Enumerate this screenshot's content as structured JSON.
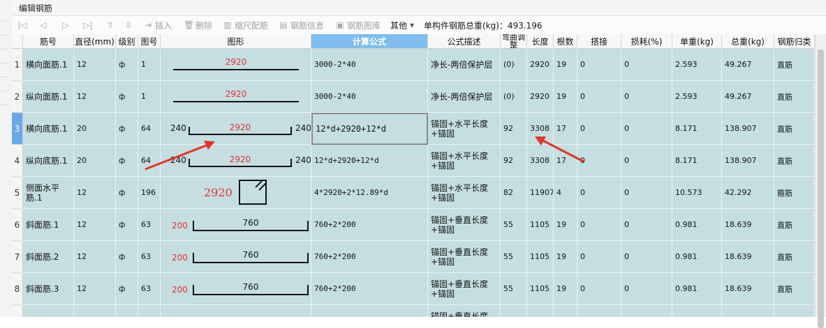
{
  "window": {
    "title": "编辑钢筋"
  },
  "toolbar": {
    "insert": "插入",
    "delete": "删除",
    "scale_rebar": "缩尺配筋",
    "rebar_info": "钢筋信息",
    "rebar_library": "钢筋图库",
    "other": "其他",
    "total_weight_label": "单构件钢筋总重(kg)：493.196"
  },
  "columns": [
    "筋号",
    "直径(mm)",
    "级别",
    "图号",
    "图形",
    "计算公式",
    "公式描述",
    "弯曲调整",
    "长度",
    "根数",
    "搭接",
    "损耗(%)",
    "单重(kg)",
    "总重(kg)",
    "钢筋归类"
  ],
  "rows": [
    {
      "num": "1",
      "name": "横向面筋.1",
      "dia": "12",
      "grade": "ф",
      "fig": "1",
      "shape": {
        "type": "straight",
        "mid": "2920"
      },
      "formula": "3000-2*40",
      "desc": "净长-两倍保护层",
      "bend": "(0)",
      "len": "2920",
      "count": "19",
      "lap": "0",
      "loss": "0",
      "unit": "2.593",
      "total": "49.267",
      "cat": "直筋"
    },
    {
      "num": "2",
      "name": "纵向面筋.1",
      "dia": "12",
      "grade": "ф",
      "fig": "1",
      "shape": {
        "type": "straight",
        "mid": "2920"
      },
      "formula": "3000-2*40",
      "desc": "净长-两倍保护层",
      "bend": "(0)",
      "len": "2920",
      "count": "19",
      "lap": "0",
      "loss": "0",
      "unit": "2.593",
      "total": "49.267",
      "cat": "直筋"
    },
    {
      "num": "3",
      "name": "横向底筋.1",
      "dia": "20",
      "grade": "ф",
      "fig": "64",
      "shape": {
        "type": "hooked",
        "left": "240",
        "mid": "2920",
        "right": "240"
      },
      "formula": "12*d+2920+12*d",
      "desc": "锚固+水平长度+锚固",
      "bend": "92",
      "len": "3308",
      "count": "17",
      "lap": "0",
      "loss": "0",
      "unit": "8.171",
      "total": "138.907",
      "cat": "直筋"
    },
    {
      "num": "4",
      "name": "纵向底筋.1",
      "dia": "20",
      "grade": "ф",
      "fig": "64",
      "shape": {
        "type": "hooked",
        "left": "240",
        "mid": "2920",
        "right": "240"
      },
      "formula": "12*d+2920+12*d",
      "desc": "锚固+水平长度+锚固",
      "bend": "92",
      "len": "3308",
      "count": "17",
      "lap": "0",
      "loss": "0",
      "unit": "8.171",
      "total": "138.907",
      "cat": "直筋"
    },
    {
      "num": "5",
      "name": "侧面水平筋.1",
      "dia": "12",
      "grade": "ф",
      "fig": "196",
      "shape": {
        "type": "stirrup",
        "mid": "2920"
      },
      "formula": "4*2920+2*12.89*d",
      "desc": "锚固+水平长度+锚固",
      "bend": "82",
      "len": "11907",
      "count": "4",
      "lap": "0",
      "loss": "0",
      "unit": "10.573",
      "total": "42.292",
      "cat": "箍筋"
    },
    {
      "num": "6",
      "name": "斜面筋.1",
      "dia": "12",
      "grade": "ф",
      "fig": "63",
      "shape": {
        "type": "uplegs",
        "left": "200",
        "mid": "760"
      },
      "formula": "760+2*200",
      "desc": "锚固+垂直长度+锚固",
      "bend": "55",
      "len": "1105",
      "count": "19",
      "lap": "0",
      "loss": "0",
      "unit": "0.981",
      "total": "18.639",
      "cat": "直筋"
    },
    {
      "num": "7",
      "name": "斜面筋.2",
      "dia": "12",
      "grade": "ф",
      "fig": "63",
      "shape": {
        "type": "uplegs",
        "left": "200",
        "mid": "760"
      },
      "formula": "760+2*200",
      "desc": "锚固+垂直长度+锚固",
      "bend": "55",
      "len": "1105",
      "count": "19",
      "lap": "0",
      "loss": "0",
      "unit": "0.981",
      "total": "18.639",
      "cat": "直筋"
    },
    {
      "num": "8",
      "name": "斜面筋.3",
      "dia": "12",
      "grade": "ф",
      "fig": "63",
      "shape": {
        "type": "uplegs",
        "left": "200",
        "mid": "760"
      },
      "formula": "760+2*200",
      "desc": "锚固+垂直长度+锚固",
      "bend": "55",
      "len": "1105",
      "count": "19",
      "lap": "0",
      "loss": "0",
      "unit": "0.981",
      "total": "18.639",
      "cat": "直筋"
    },
    {
      "num": "",
      "name": "",
      "dia": "",
      "grade": "",
      "fig": "",
      "shape": {
        "type": "none",
        "mid": ""
      },
      "formula": "",
      "desc": "锚固+垂直长度+锚固",
      "bend": "",
      "len": "",
      "count": "",
      "lap": "",
      "loss": "",
      "unit": "",
      "total": "",
      "cat": ""
    }
  ],
  "selected_row": "3",
  "selected_column": "计算公式",
  "colors": {
    "row_bg": "#c5dfe1",
    "selected_header": "#7fbdf0",
    "annotation": "#e8312a",
    "shape_text": "#e53030"
  }
}
